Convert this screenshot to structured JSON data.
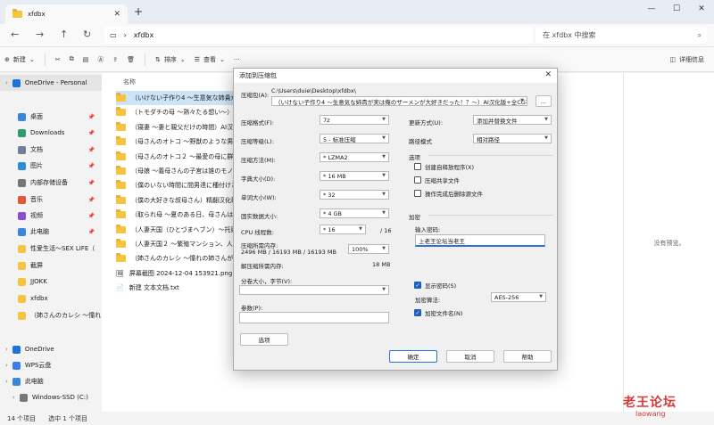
{
  "window": {
    "tab_title": "xfdbx",
    "new_tab": "+",
    "controls": {
      "minimize": "—",
      "maximize": "☐",
      "close": "✕"
    }
  },
  "nav": {
    "path": "xfdbx",
    "search_placeholder": "在 xfdbx 中搜索"
  },
  "toolbar": {
    "new_label": "新建",
    "sort_label": "排序",
    "view_label": "查看",
    "more_label": "···",
    "details_label": "详细信息"
  },
  "sidebar": {
    "items": [
      {
        "label": "OneDrive - Personal",
        "color": "#1e73d8"
      },
      {
        "label": "桌面",
        "color": "#3b87d6"
      },
      {
        "label": "Downloads",
        "color": "#2f9e6a"
      },
      {
        "label": "文档",
        "color": "#6d7f99"
      },
      {
        "label": "图片",
        "color": "#2d8fd6"
      },
      {
        "label": "内部存储设备",
        "color": "#777777"
      },
      {
        "label": "音乐",
        "color": "#e0573b"
      },
      {
        "label": "视频",
        "color": "#8a4fd1"
      },
      {
        "label": "此电脑",
        "color": "#3b87d6"
      },
      {
        "label": "性爱生活～SEX LIFE（",
        "color": "#f5c542"
      },
      {
        "label": "截屏",
        "color": "#f5c542"
      },
      {
        "label": "JJOKK",
        "color": "#f5c542"
      },
      {
        "label": "xfdbx",
        "color": "#f5c542"
      },
      {
        "label": "（姉さんのカレシ ～憧れ",
        "color": "#f5c542"
      },
      {
        "label": "OneDrive",
        "color": "#1e73d8"
      },
      {
        "label": "WPS云盘",
        "color": "#3b7ee8"
      },
      {
        "label": "此电脑",
        "color": "#3b87d6"
      },
      {
        "label": "Windows-SSD (C:)",
        "color": "#777777"
      }
    ]
  },
  "filelist": {
    "column_header": "名称",
    "files": [
      "（いけない子作り4 ～生意気な姉貴が",
      "（トモダチの母 ～熟々たる想い～）AI",
      "（寝妻 ～妻と親父だけの時間）AI汉化",
      "（母さんのオトコ ～野獣のような男に",
      "（母さんのオトコ２ ～最愛の母に群が",
      "（母娘 ～義母さんの子宮は誰のモノ？",
      "（僕のいない時間に間男達に種付けさ",
      "（僕の大好きな叔母さん）精翻汉化破",
      "（取られ母 ～夏のある日、母さんは",
      "（人妻天国（ひとづまヘブン）～托卵",
      "（人妻天国２ ～繁殖マンション、人妻",
      "（姉さんのカレシ ～憧れの姉さんが",
      "屏幕截图 2024-12-04 153921.png",
      "新建 文本文档.txt"
    ]
  },
  "preview": {
    "text": "没有预览。"
  },
  "status": {
    "count": "14 个项目",
    "selected": "选中 1 个项目"
  },
  "watermark": {
    "line1": "老王论坛",
    "line2": "laowang"
  },
  "dialog": {
    "title": "添加到压缩包",
    "close": "✕",
    "archive_label": "压缩包(A):",
    "archive_dir": "C:\\Users\\duie\\Desktop\\xfdbx\\",
    "archive_name": "（いけない子作り4 ～生意気な姉貴が実は俺のザーメンが大好きだった！？～）AI汉化版+全CG存",
    "browse": "...",
    "format_label": "压缩格式(F):",
    "format_value": "7z",
    "level_label": "压缩等级(L):",
    "level_value": "5 - 标准压缩",
    "method_label": "压缩方法(M):",
    "method_value": "* LZMA2",
    "dict_label": "字典大小(D):",
    "dict_value": "* 16 MB",
    "word_label": "单词大小(W):",
    "word_value": "* 32",
    "solid_label": "固实数据大小:",
    "solid_value": "* 4 GB",
    "threads_label": "CPU 线程数:",
    "threads_value": "* 16",
    "threads_total": "/ 16",
    "mem_label": "压缩所需内存:",
    "mem_value": "2496 MB / 16193 MB / 16193 MB",
    "mem_percent": "100%",
    "decomp_label": "解压缩所需内存:",
    "decomp_value": "18 MB",
    "split_label": "分卷大小，字节(V):",
    "params_label": "参数(P):",
    "options_button": "选项",
    "update_label": "更新方式(U):",
    "update_value": "添加并替换文件",
    "path_label": "路径模式",
    "path_value": "相对路径",
    "options_group": "选项",
    "opt_sfx": "创建自释放程序(X)",
    "opt_shared": "压缩共享文件",
    "opt_delete": "操作完成后删除源文件",
    "encrypt_group": "加密",
    "pw_label": "输入密码:",
    "pw_value": "上老王论坛当老王",
    "show_pw": "显示密码(S)",
    "enc_method_label": "加密算法:",
    "enc_method_value": "AES-256",
    "enc_names": "加密文件名(N)",
    "ok": "确定",
    "cancel": "取消",
    "help": "帮助"
  }
}
